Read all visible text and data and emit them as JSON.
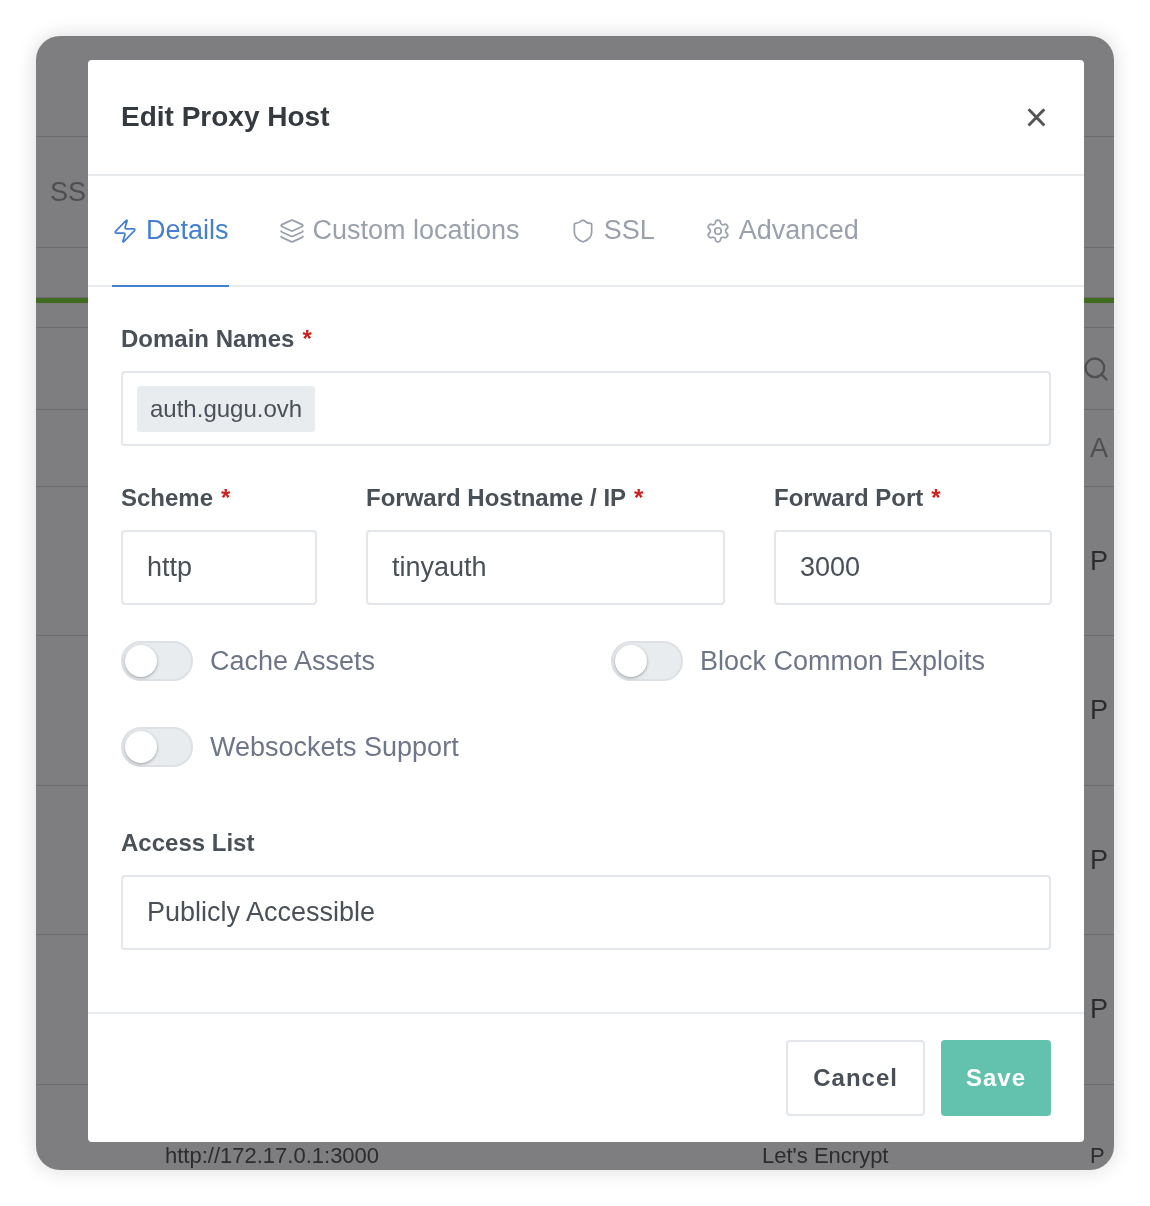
{
  "background": {
    "tab_label": "SS",
    "column_heading": "A",
    "rows": [
      {
        "cell": "P"
      },
      {
        "cell": "P"
      },
      {
        "cell": "P"
      },
      {
        "cell": "P"
      }
    ],
    "last_row": {
      "destination": "http://172.17.0.1:3000",
      "ssl": "Let's Encrypt",
      "access": "P"
    }
  },
  "dialog": {
    "title": "Edit Proxy Host",
    "close": "×",
    "tabs": [
      {
        "label": "Details",
        "selected": true
      },
      {
        "label": "Custom locations",
        "selected": false
      },
      {
        "label": "SSL",
        "selected": false
      },
      {
        "label": "Advanced",
        "selected": false
      }
    ],
    "domain_names": {
      "label": "Domain Names",
      "required_mark": "*",
      "chips": [
        "auth.gugu.ovh"
      ]
    },
    "row_fields": [
      {
        "label": "Scheme",
        "required_mark": "*",
        "value": "http"
      },
      {
        "label": "Forward Hostname / IP",
        "required_mark": "*",
        "value": "tinyauth"
      },
      {
        "label": "Forward Port",
        "required_mark": "*",
        "value": "3000"
      }
    ],
    "toggles": [
      {
        "label": "Cache Assets",
        "on": false
      },
      {
        "label": "Block Common Exploits",
        "on": false
      },
      {
        "label": "Websockets Support",
        "on": false
      }
    ],
    "access_list": {
      "label": "Access List",
      "value": "Publicly Accessible"
    },
    "buttons": [
      {
        "label": "Cancel",
        "kind": "secondary"
      },
      {
        "label": "Save",
        "kind": "primary"
      }
    ]
  }
}
